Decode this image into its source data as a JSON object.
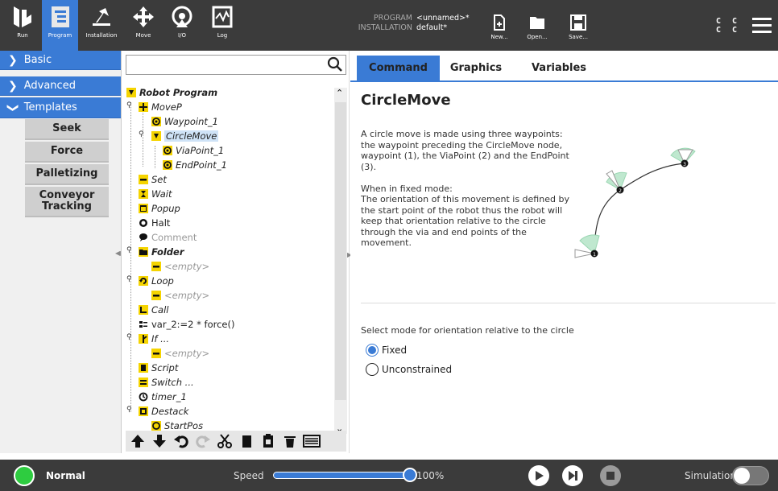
{
  "header": {
    "nav": [
      {
        "label": "Run",
        "icon": "ur-logo-icon"
      },
      {
        "label": "Program",
        "icon": "program-icon",
        "active": true
      },
      {
        "label": "Installation",
        "icon": "installation-icon"
      },
      {
        "label": "Move",
        "icon": "move-icon"
      },
      {
        "label": "I/O",
        "icon": "io-icon"
      },
      {
        "label": "Log",
        "icon": "log-icon"
      }
    ],
    "program_label": "PROGRAM",
    "program_name": "<unnamed>*",
    "installation_label": "INSTALLATION",
    "installation_name": "default*",
    "file_buttons": [
      {
        "label": "New...",
        "icon": "new-file-icon"
      },
      {
        "label": "Open...",
        "icon": "open-folder-icon"
      },
      {
        "label": "Save...",
        "icon": "save-icon"
      }
    ],
    "cc_top": "C C",
    "cc_bottom": "C C"
  },
  "sidebar": {
    "sections": [
      {
        "label": "Basic",
        "expanded": false
      },
      {
        "label": "Advanced",
        "expanded": false
      },
      {
        "label": "Templates",
        "expanded": true
      }
    ],
    "template_items": [
      "Seek",
      "Force",
      "Palletizing",
      "Conveyor Tracking"
    ]
  },
  "tree": {
    "search_value": "",
    "items": [
      {
        "label": "Robot Program",
        "icon": "robot-program-icon"
      },
      {
        "label": "MoveP",
        "icon": "move-icon"
      },
      {
        "label": "Waypoint_1",
        "icon": "waypoint-icon"
      },
      {
        "label": "CircleMove",
        "icon": "circle-move-icon",
        "selected": true
      },
      {
        "label": "ViaPoint_1",
        "icon": "waypoint-icon"
      },
      {
        "label": "EndPoint_1",
        "icon": "waypoint-icon"
      },
      {
        "label": "Set",
        "icon": "set-icon"
      },
      {
        "label": "Wait",
        "icon": "wait-icon"
      },
      {
        "label": "Popup",
        "icon": "popup-icon"
      },
      {
        "label": "Halt",
        "icon": "halt-icon"
      },
      {
        "label": "Comment",
        "icon": "comment-icon"
      },
      {
        "label": "Folder",
        "icon": "folder-icon"
      },
      {
        "label": "<empty>",
        "icon": "empty-icon"
      },
      {
        "label": "Loop",
        "icon": "loop-icon"
      },
      {
        "label": "<empty>",
        "icon": "empty-icon"
      },
      {
        "label": "Call",
        "icon": "call-icon"
      },
      {
        "label": "var_2:=2 * force()",
        "icon": "assignment-icon"
      },
      {
        "label": "If ...",
        "icon": "if-icon"
      },
      {
        "label": "<empty>",
        "icon": "empty-icon"
      },
      {
        "label": "Script",
        "icon": "script-icon"
      },
      {
        "label": "Switch ...",
        "icon": "switch-icon"
      },
      {
        "label": "timer_1",
        "icon": "timer-icon"
      },
      {
        "label": "Destack",
        "icon": "destack-icon"
      },
      {
        "label": "StartPos",
        "icon": "waypoint-icon"
      }
    ],
    "toolbar": [
      "move-up-icon",
      "move-down-icon",
      "undo-icon",
      "redo-icon",
      "cut-icon",
      "copy-icon",
      "paste-icon",
      "delete-icon",
      "suppress-icon"
    ]
  },
  "main": {
    "tabs": [
      "Command",
      "Graphics",
      "Variables"
    ],
    "active_tab": "Command",
    "title": "CircleMove",
    "description": "A circle move is made using three waypoints: the waypoint preceding the CircleMove node, waypoint (1), the ViaPoint (2) and the EndPoint (3).\n\nWhen in fixed mode:\nThe orientation of this movement is defined by the start point of the robot thus the robot will keep that orientation relative to the circle through the via and end points of the movement.",
    "diagram_points": [
      "1",
      "2",
      "3"
    ],
    "select_label": "Select mode for orientation relative to the circle",
    "options": [
      {
        "label": "Fixed",
        "checked": true
      },
      {
        "label": "Unconstrained",
        "checked": false
      }
    ]
  },
  "footer": {
    "status": "Normal",
    "speed_label": "Speed",
    "speed_value": "100%",
    "speed_fraction": 1.0,
    "simulation_label": "Simulation",
    "simulation_on": false,
    "accent": "#3a7bd5",
    "status_color": "#2ecc40"
  }
}
